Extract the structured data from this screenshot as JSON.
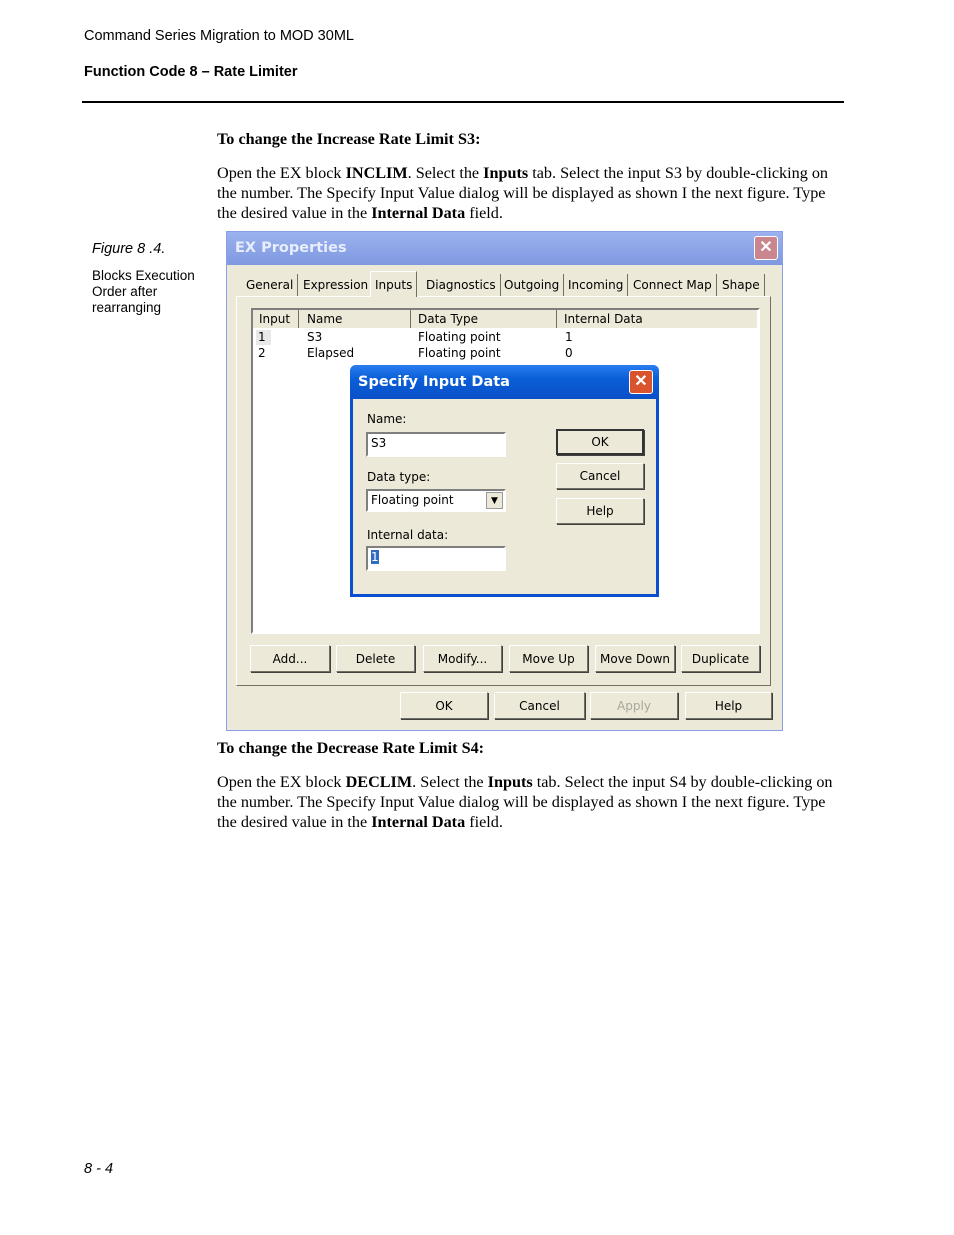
{
  "header": {
    "doc_title": "Command Series Migration to MOD 30ML",
    "section": "Function Code 8 – Rate Limiter"
  },
  "section1": {
    "heading": "To change the Increase Rate Limit S3:",
    "p": [
      "Open the EX block ",
      "INCLIM",
      ". Select the ",
      "Inputs",
      " tab. Select the input S3 by double-clicking on the number. The Specify Input Value dialog will be displayed as shown I the next figure. Type the desired value in the ",
      "Internal Data",
      " field."
    ]
  },
  "figure": {
    "label": "Figure 8 .4.",
    "caption": "Blocks Execution Order after rearranging"
  },
  "ex_window": {
    "title": "EX Properties",
    "tabs": [
      "General",
      "Expression",
      "Inputs",
      "Diagnostics",
      "Outgoing",
      "Incoming",
      "Connect Map",
      "Shape"
    ],
    "active_tab": "Inputs",
    "columns": [
      "Input",
      "Name",
      "Data Type",
      "Internal Data"
    ],
    "rows": [
      [
        "1",
        "S3",
        "Floating point",
        "1"
      ],
      [
        "2",
        "Elapsed",
        "Floating point",
        "0"
      ]
    ],
    "list_buttons": [
      "Add...",
      "Delete",
      "Modify...",
      "Move Up",
      "Move Down",
      "Duplicate"
    ],
    "footer_buttons": {
      "ok": "OK",
      "cancel": "Cancel",
      "apply": "Apply",
      "help": "Help"
    }
  },
  "dialog": {
    "title": "Specify Input Data",
    "name_label": "Name:",
    "name_value": "S3",
    "type_label": "Data type:",
    "type_value": "Floating point",
    "internal_label": "Internal data:",
    "internal_value": "1",
    "ok": "OK",
    "cancel": "Cancel",
    "help": "Help"
  },
  "section2": {
    "heading": "To change the Decrease Rate Limit S4:",
    "p": [
      "Open the EX block ",
      "DECLIM",
      ". Select the ",
      "Inputs",
      " tab. Select the input S4 by double-clicking on the number. The Specify Input Value dialog will be displayed as shown I the next figure. Type the desired value in the ",
      "Internal Data",
      " field."
    ]
  },
  "footer": {
    "page_number": "8 - 4"
  },
  "colors": {
    "dialog_title": "#0a5fd8",
    "window_title_faded": "#7f98e0",
    "face": "#ece9d8",
    "close_red": "#d9532c"
  }
}
